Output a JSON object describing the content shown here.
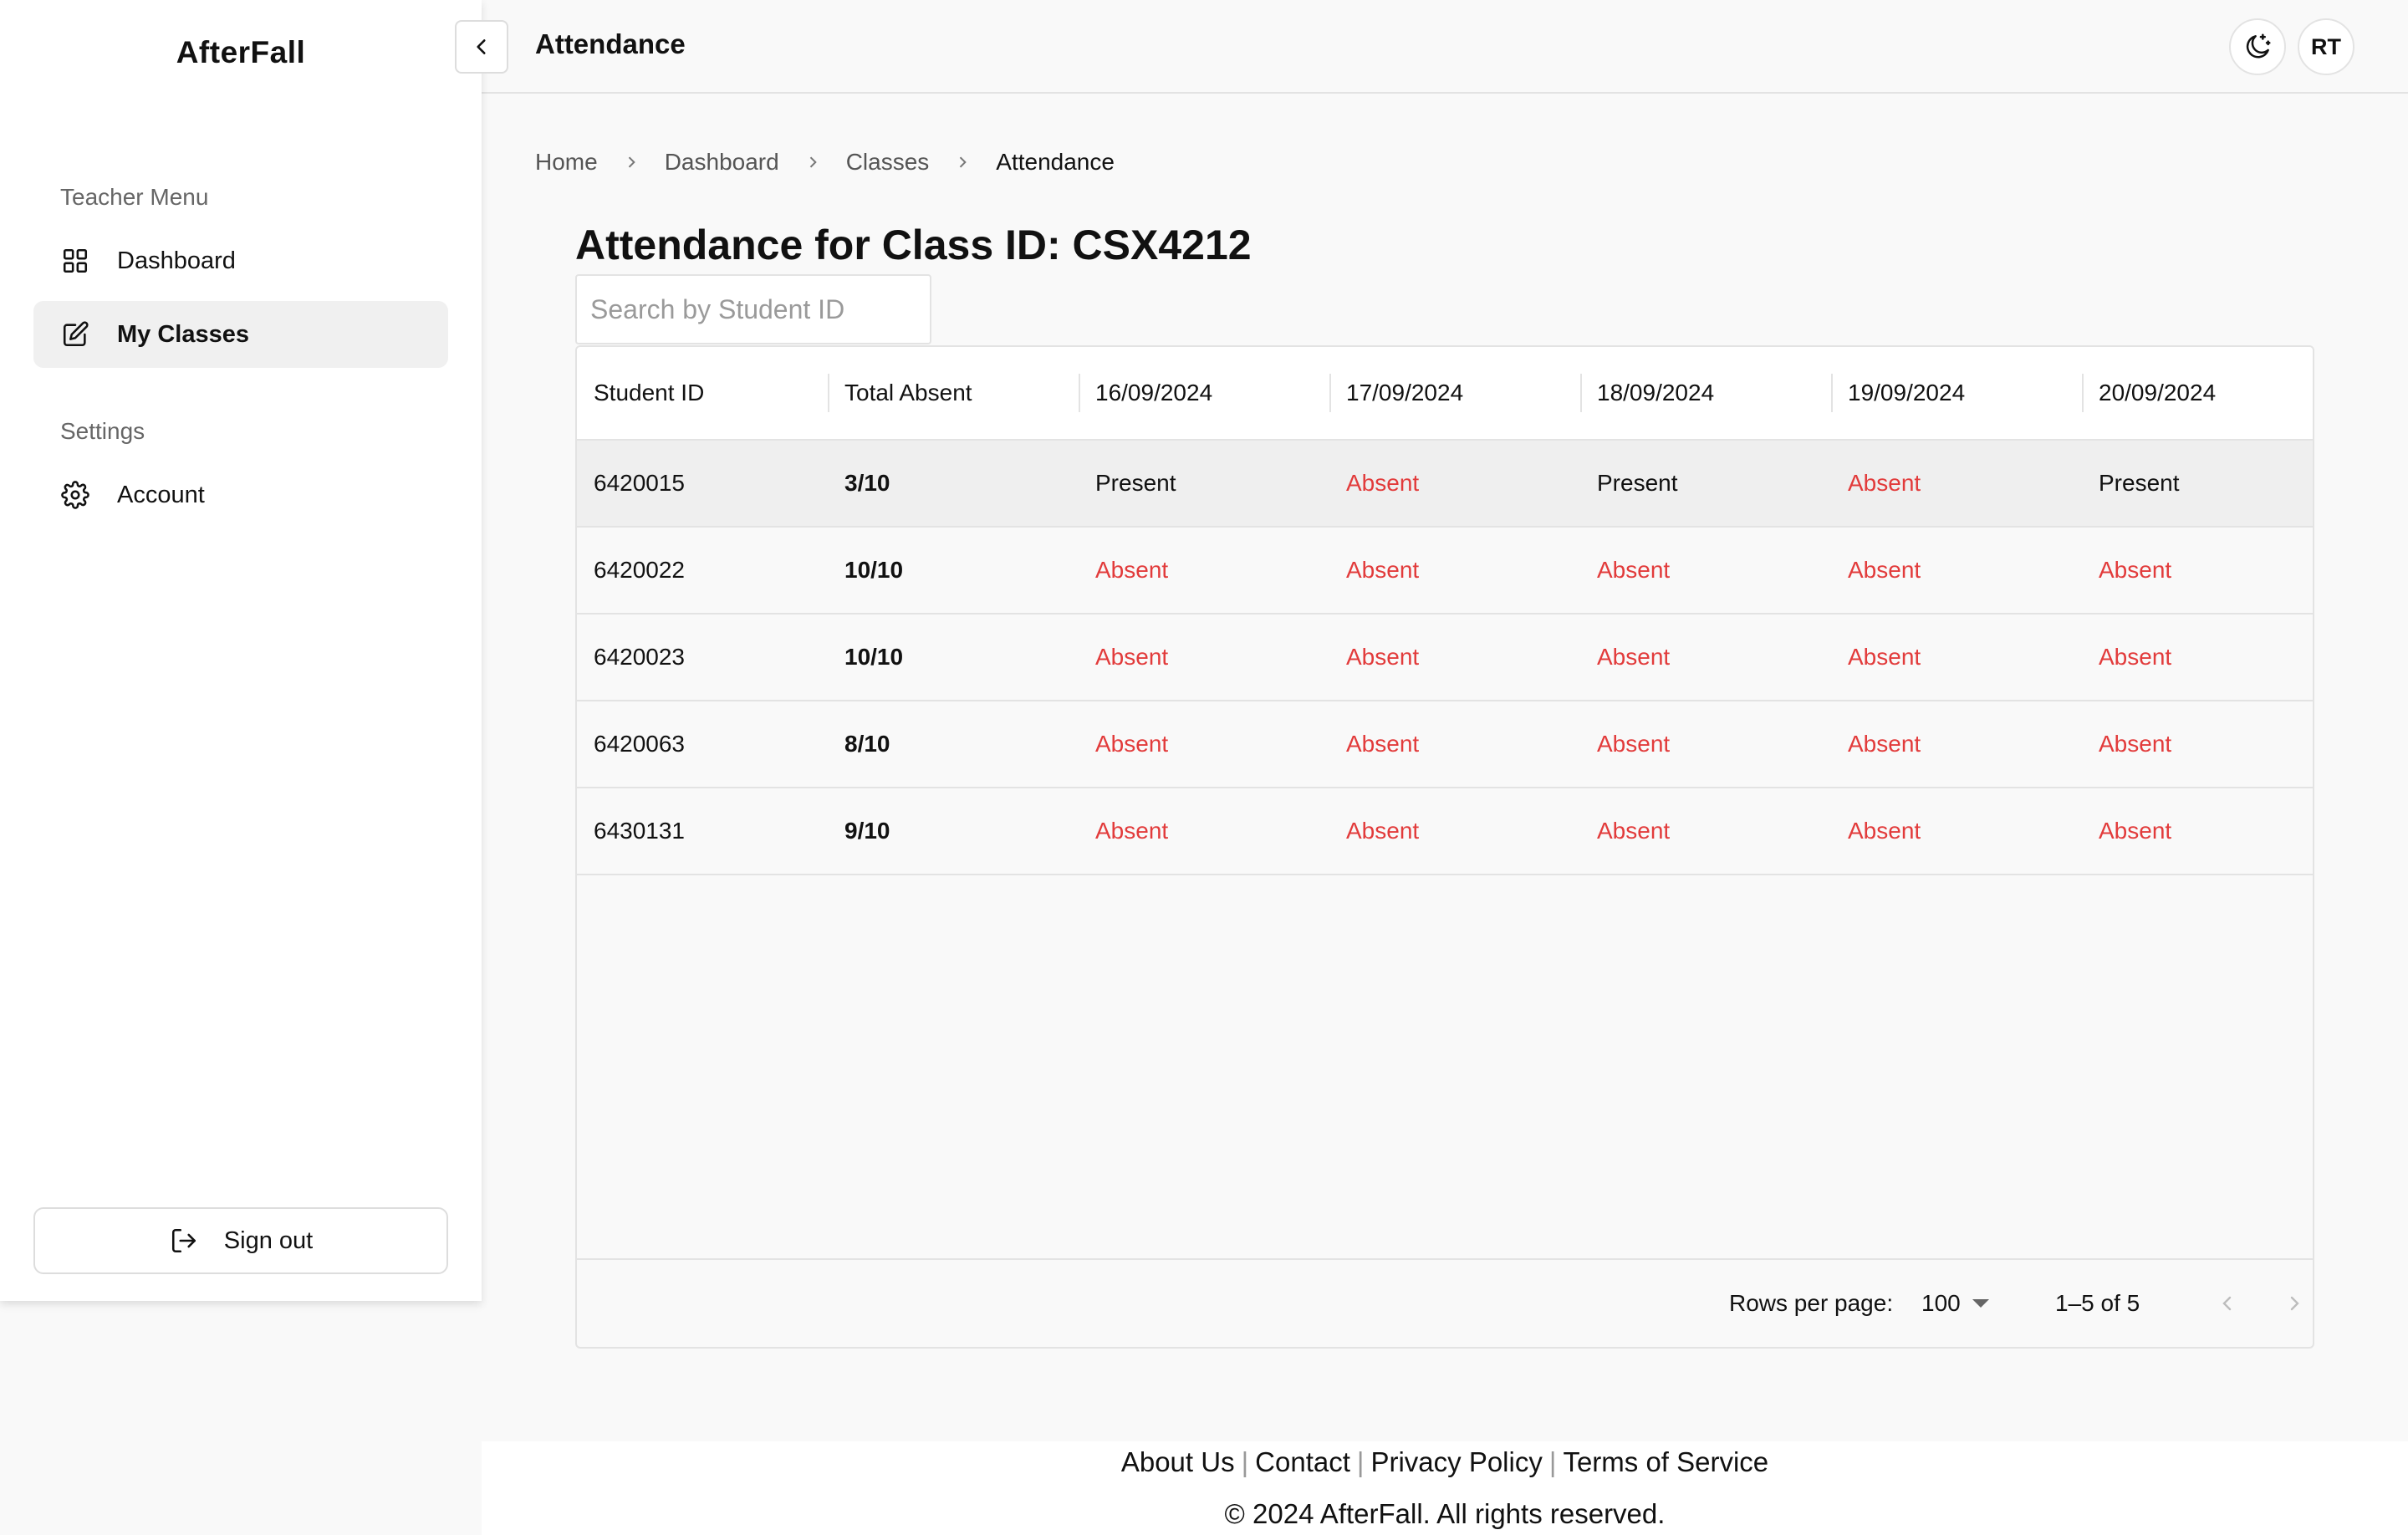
{
  "app": {
    "brand": "AfterFall"
  },
  "sidebar": {
    "teacher_heading": "Teacher Menu",
    "items": [
      {
        "label": "Dashboard",
        "icon": "grid-icon"
      },
      {
        "label": "My Classes",
        "icon": "edit-icon",
        "active": true
      }
    ],
    "settings_heading": "Settings",
    "settings_items": [
      {
        "label": "Account",
        "icon": "gear-icon"
      }
    ],
    "signout_label": "Sign out"
  },
  "header": {
    "title": "Attendance",
    "theme_icon": "moon-icon",
    "avatar_initials": "RT"
  },
  "breadcrumb": [
    "Home",
    "Dashboard",
    "Classes",
    "Attendance"
  ],
  "page": {
    "title": "Attendance for Class ID: CSX4212",
    "search_placeholder": "Search by Student ID"
  },
  "table": {
    "columns": [
      "Student ID",
      "Total Absent",
      "16/09/2024",
      "17/09/2024",
      "18/09/2024",
      "19/09/2024",
      "20/09/2024"
    ],
    "rows": [
      {
        "id": "6420015",
        "total": "3/10",
        "days": [
          "Present",
          "Absent",
          "Present",
          "Absent",
          "Present"
        ]
      },
      {
        "id": "6420022",
        "total": "10/10",
        "days": [
          "Absent",
          "Absent",
          "Absent",
          "Absent",
          "Absent"
        ]
      },
      {
        "id": "6420023",
        "total": "10/10",
        "days": [
          "Absent",
          "Absent",
          "Absent",
          "Absent",
          "Absent"
        ]
      },
      {
        "id": "6420063",
        "total": "8/10",
        "days": [
          "Absent",
          "Absent",
          "Absent",
          "Absent",
          "Absent"
        ]
      },
      {
        "id": "6430131",
        "total": "9/10",
        "days": [
          "Absent",
          "Absent",
          "Absent",
          "Absent",
          "Absent"
        ]
      }
    ],
    "footer": {
      "rows_per_page_label": "Rows per page:",
      "rows_per_page_value": "100",
      "range": "1–5 of 5"
    }
  },
  "colors": {
    "absent": "#e23b3b",
    "accent": "#111111"
  },
  "footer": {
    "links": [
      "About Us",
      "Contact",
      "Privacy Policy",
      "Terms of Service"
    ],
    "copyright": "© 2024 AfterFall. All rights reserved."
  }
}
